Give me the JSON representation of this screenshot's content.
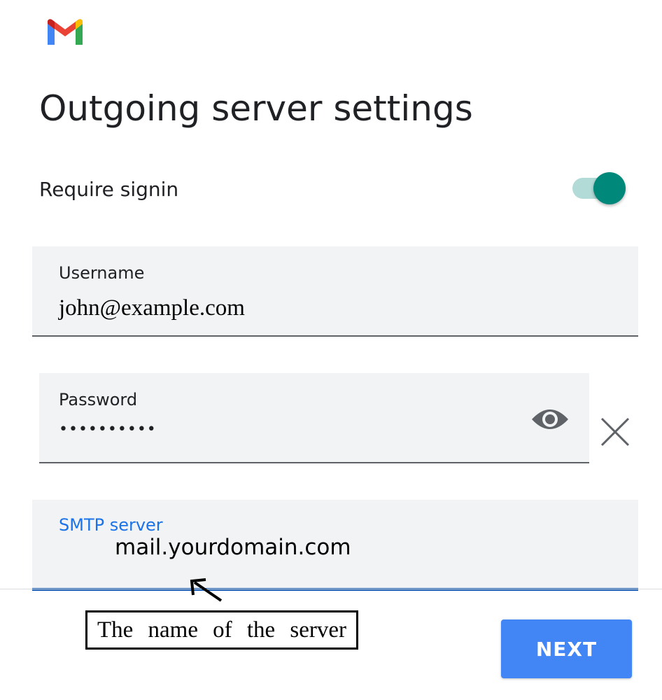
{
  "app": {
    "logo_icon": "gmail-logo-icon"
  },
  "page": {
    "title": "Outgoing server settings"
  },
  "require_signin": {
    "label": "Require signin",
    "enabled": true,
    "accent_color": "#00897b"
  },
  "fields": {
    "username": {
      "label": "Username",
      "value": "john@example.com"
    },
    "password": {
      "label": "Password",
      "value": "••••••••••",
      "reveal_icon": "eye-icon",
      "clear_icon": "close-icon"
    },
    "smtp_server": {
      "label": "SMTP server",
      "value": "mail.yourdomain.com",
      "focus_color": "#1a5fb4"
    }
  },
  "annotation": {
    "text": "The name of the server",
    "icon": "arrow-icon"
  },
  "actions": {
    "next_label": "NEXT",
    "next_color": "#4285f4"
  }
}
